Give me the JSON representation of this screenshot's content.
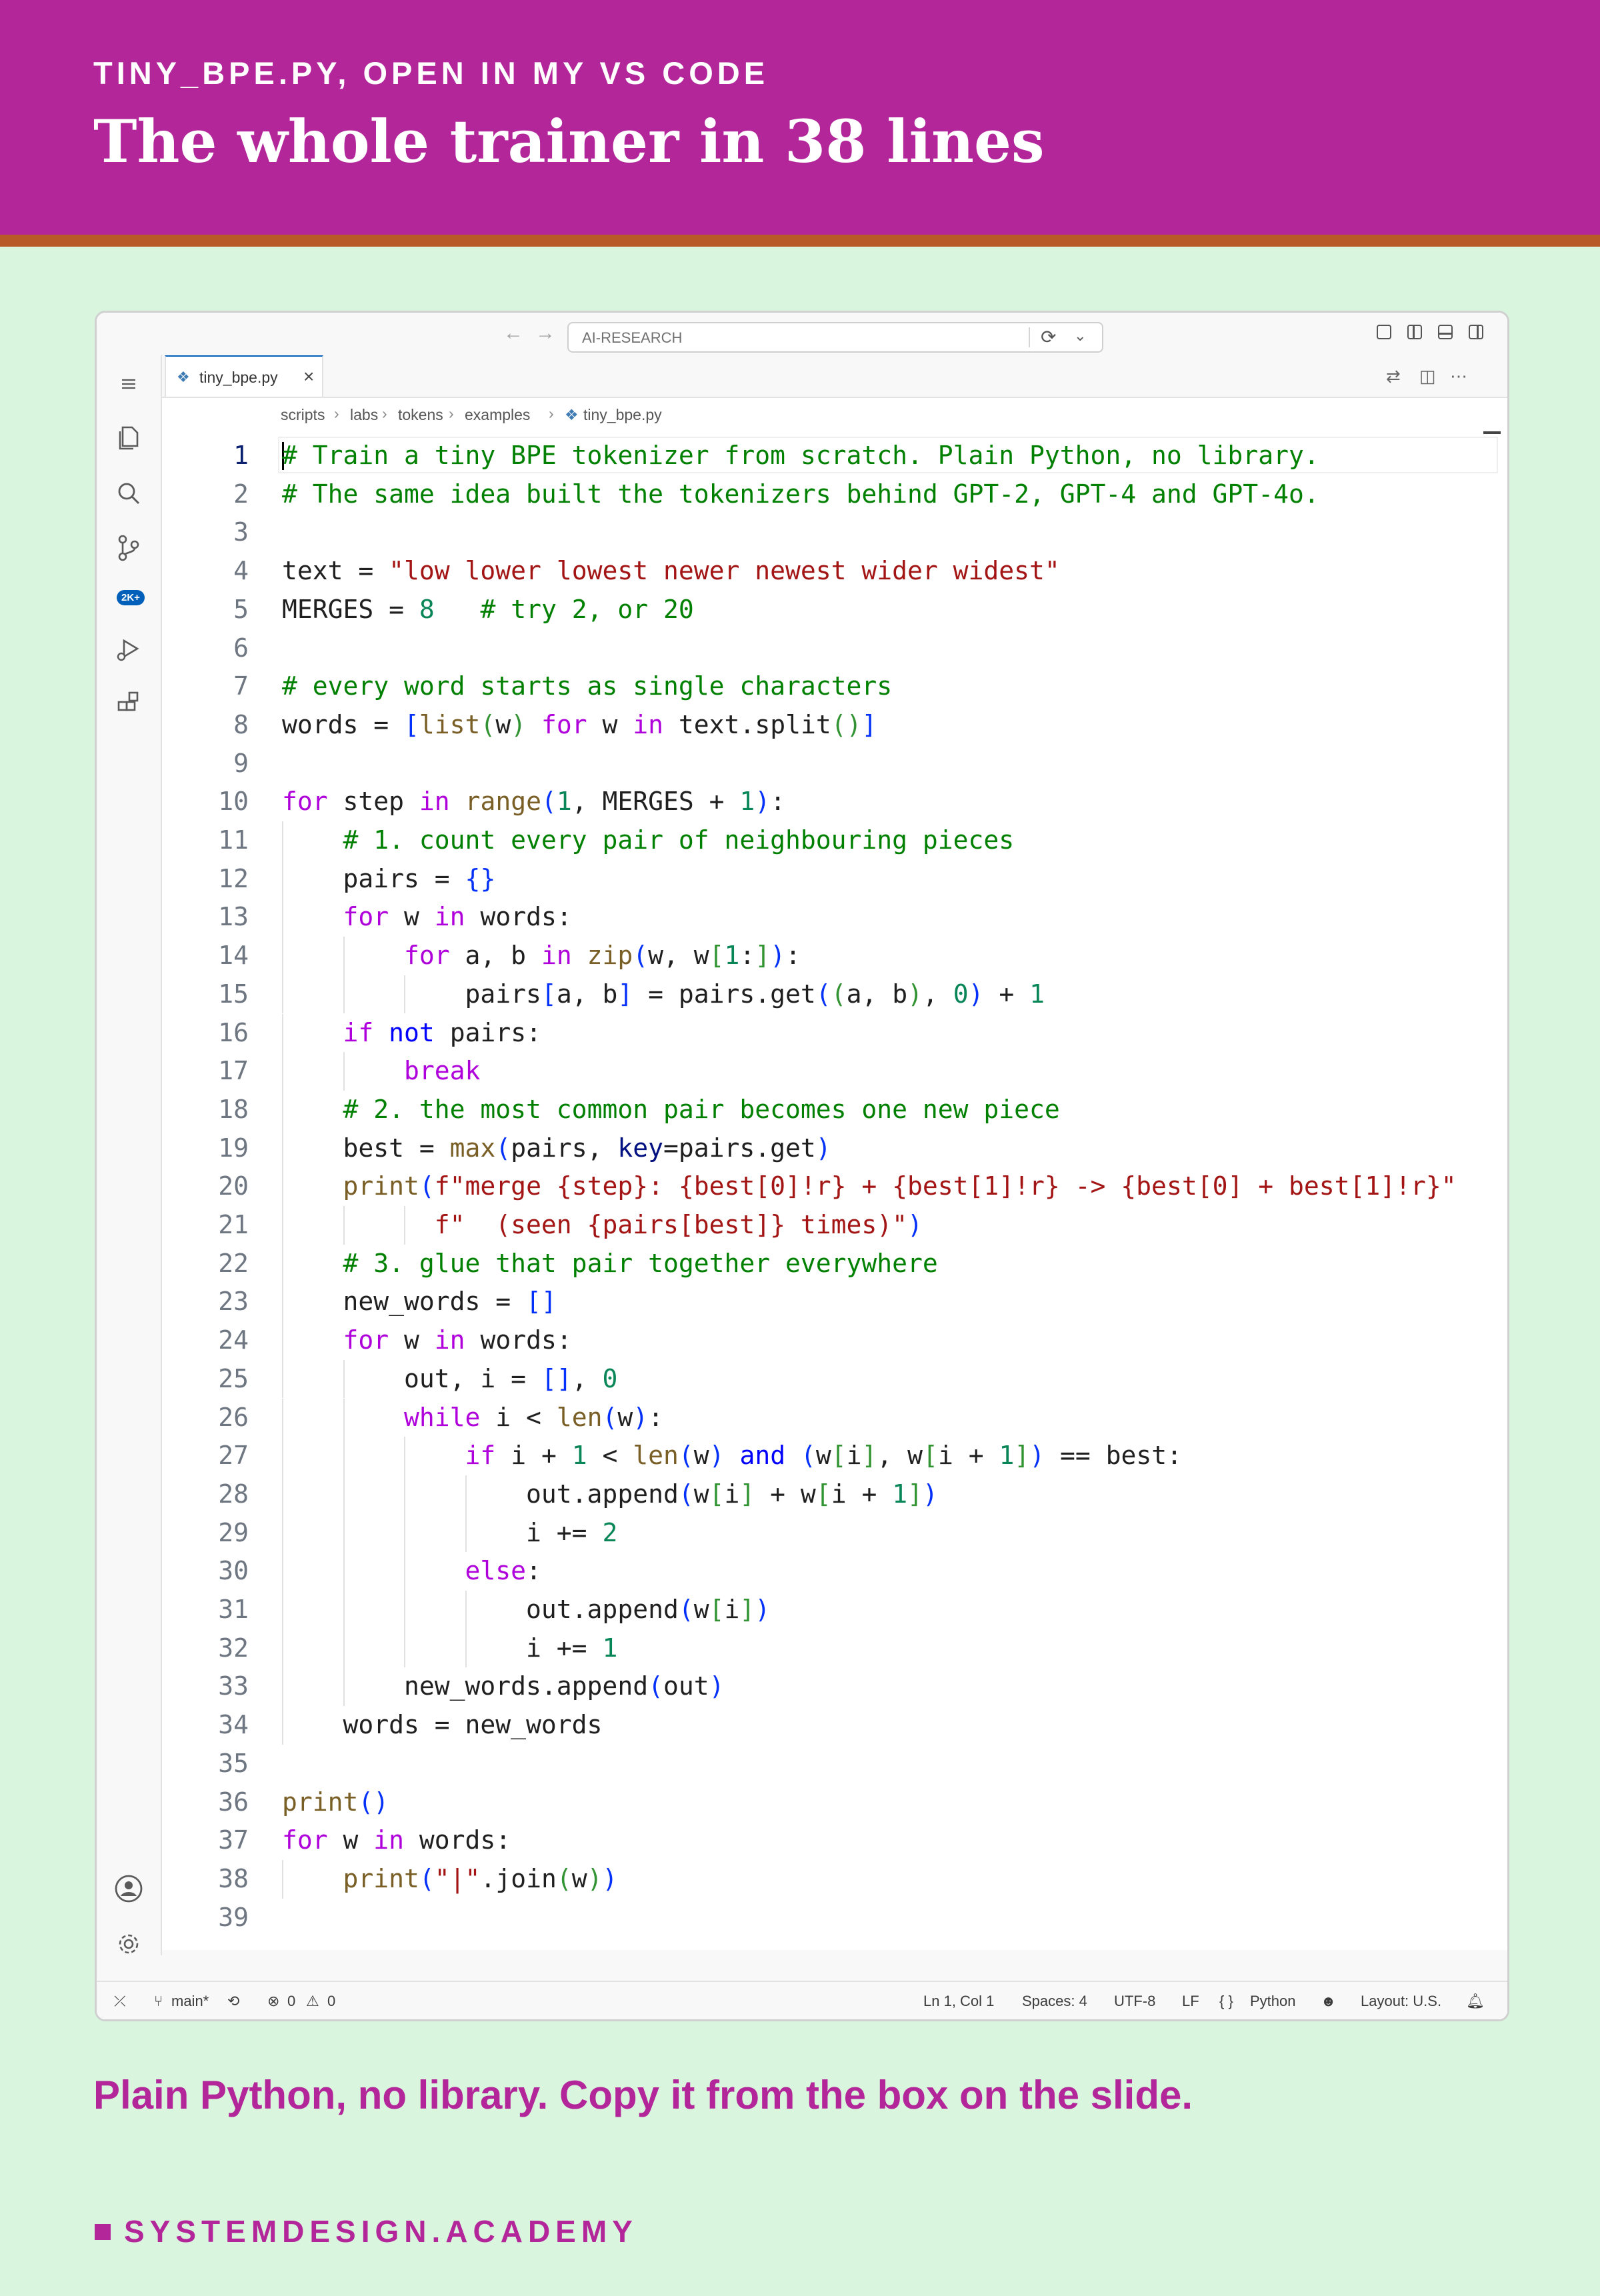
{
  "slide": {
    "kicker": "TINY_BPE.PY, OPEN IN MY VS CODE",
    "headline": "The whole trainer in 38 lines",
    "caption": "Plain Python, no library. Copy it from the box on the slide.",
    "brand": "SYSTEMDESIGN.ACADEMY"
  },
  "colors": {
    "header": "#b2269a",
    "header_rule": "#b85a28",
    "background": "#d9f5de",
    "accent_text": "#b2269a"
  },
  "window": {
    "command_center": "AI-RESEARCH",
    "tab_label": "tiny_bpe.py",
    "breadcrumb": [
      "scripts",
      "labs",
      "tokens",
      "examples",
      "tiny_bpe.py"
    ],
    "source_control_badge": "2K+"
  },
  "icons": {
    "activity": [
      "menu-icon",
      "explorer-icon",
      "search-icon",
      "source-control-icon",
      "run-debug-icon",
      "extensions-icon",
      "account-icon",
      "settings-gear-icon"
    ]
  },
  "editor": {
    "active_line": 1,
    "lines": [
      "# Train a tiny BPE tokenizer from scratch. Plain Python, no library.",
      "# The same idea built the tokenizers behind GPT-2, GPT-4 and GPT-4o.",
      "",
      "text = \"low lower lowest newer newest wider widest\"",
      "MERGES = 8   # try 2, or 20",
      "",
      "# every word starts as single characters",
      "words = [list(w) for w in text.split()]",
      "",
      "for step in range(1, MERGES + 1):",
      "    # 1. count every pair of neighbouring pieces",
      "    pairs = {}",
      "    for w in words:",
      "        for a, b in zip(w, w[1:]):",
      "            pairs[a, b] = pairs.get((a, b), 0) + 1",
      "    if not pairs:",
      "        break",
      "    # 2. the most common pair becomes one new piece",
      "    best = max(pairs, key=pairs.get)",
      "    print(f\"merge {step}: {best[0]!r} + {best[1]!r} -> {best[0] + best[1]!r}\"",
      "          f\"  (seen {pairs[best]} times)\")",
      "    # 3. glue that pair together everywhere",
      "    new_words = []",
      "    for w in words:",
      "        out, i = [], 0",
      "        while i < len(w):",
      "            if i + 1 < len(w) and (w[i], w[i + 1]) == best:",
      "                out.append(w[i] + w[i + 1])",
      "                i += 2",
      "            else:",
      "                out.append(w[i])",
      "                i += 1",
      "        new_words.append(out)",
      "    words = new_words",
      "",
      "print()",
      "for w in words:",
      "    print(\"|\".join(w))",
      ""
    ]
  },
  "statusbar": {
    "branch": "main*",
    "errors": "0",
    "warnings": "0",
    "cursor": "Ln 1, Col 1",
    "indent": "Spaces: 4",
    "encoding": "UTF-8",
    "eol": "LF",
    "language": "Python",
    "layout": "Layout: U.S."
  }
}
